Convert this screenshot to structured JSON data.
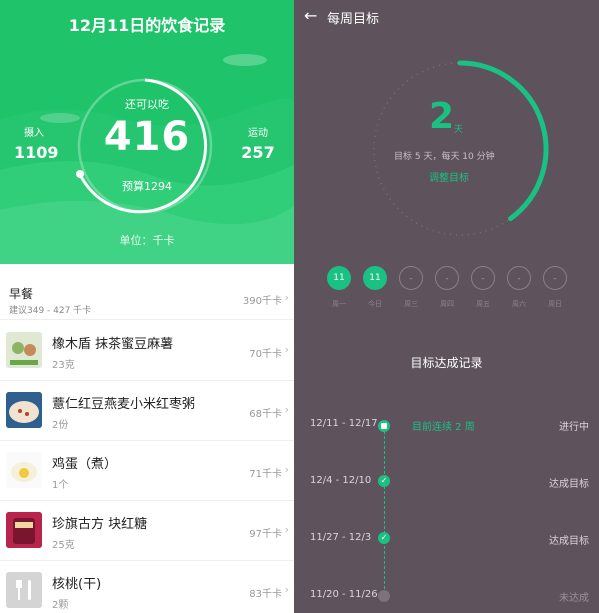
{
  "left": {
    "title": "12月11日的饮食记录",
    "remaining_label": "还可以吃",
    "remaining_value": "416",
    "budget": "预算1294",
    "intake_label": "摄入",
    "intake_value": "1109",
    "exercise_label": "运动",
    "exercise_value": "257",
    "unit": "单位：千卡",
    "meal": {
      "name": "早餐",
      "suggest": "建议349 - 427 千卡",
      "kcal": "390千卡"
    },
    "foods": [
      {
        "name": "橡木盾 抹茶蜜豆麻薯",
        "qty": "23克",
        "kcal": "70千卡"
      },
      {
        "name": "薏仁红豆燕麦小米红枣粥",
        "qty": "2份",
        "kcal": "68千卡"
      },
      {
        "name": "鸡蛋（煮）",
        "qty": "1个",
        "kcal": "71千卡"
      },
      {
        "name": "珍旗古方 块红糖",
        "qty": "25克",
        "kcal": "97千卡"
      },
      {
        "name": "核桃(干)",
        "qty": "2颗",
        "kcal": "83千卡"
      }
    ],
    "colors": {
      "brand_green": "#1fc46a"
    }
  },
  "right": {
    "title": "每周目标",
    "days_done": "2",
    "days_unit": "天",
    "goal_desc": "目标 5 天，每天 10 分钟",
    "adjust_link": "调整目标",
    "week": [
      {
        "value": "11",
        "label": "周一",
        "done": true
      },
      {
        "value": "11",
        "label": "今日",
        "done": true
      },
      {
        "value": "-",
        "label": "周三",
        "done": false
      },
      {
        "value": "-",
        "label": "周四",
        "done": false
      },
      {
        "value": "-",
        "label": "周五",
        "done": false
      },
      {
        "value": "-",
        "label": "周六",
        "done": false
      },
      {
        "value": "-",
        "label": "周日",
        "done": false
      }
    ],
    "record_title": "目标达成记录",
    "records": [
      {
        "range": "12/11 - 12/17",
        "status": "进行中",
        "note": "目前连续 2 周"
      },
      {
        "range": "12/4 - 12/10",
        "status": "达成目标"
      },
      {
        "range": "11/27 - 12/3",
        "status": "达成目标"
      },
      {
        "range": "11/20 - 11/26",
        "status": "未达成"
      }
    ],
    "progress_fraction": 0.4,
    "colors": {
      "bg": "#5e525d",
      "accent": "#1ac183"
    }
  }
}
